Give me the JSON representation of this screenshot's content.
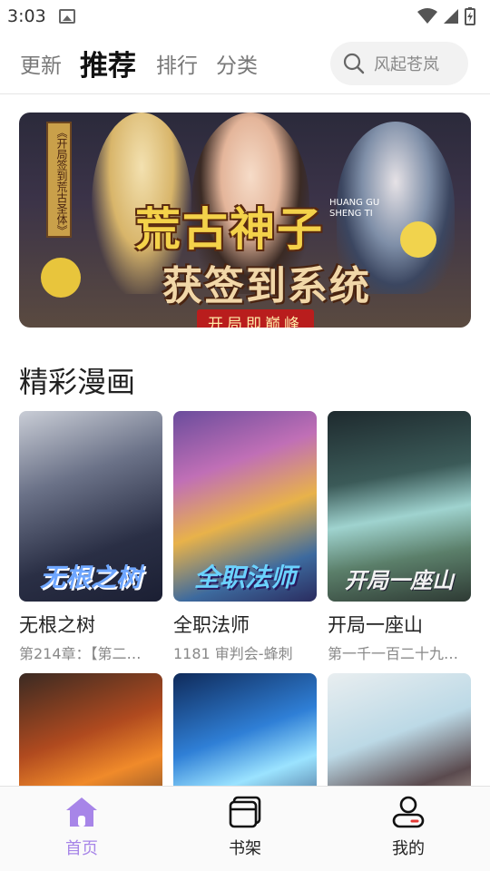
{
  "status": {
    "time": "3:03"
  },
  "tabs": [
    {
      "label": "更新"
    },
    {
      "label": "推荐"
    },
    {
      "label": "排行"
    },
    {
      "label": "分类"
    }
  ],
  "search": {
    "placeholder": "风起苍岚"
  },
  "banner": {
    "title_line1": "荒古神子",
    "title_line2": "获签到系统",
    "tag": "开局即巅峰",
    "vertical_text": "《开局签到荒古圣体》",
    "pinyin_1": "HUANG GU",
    "pinyin_2": "SHENG TI"
  },
  "section": {
    "title": "精彩漫画"
  },
  "comics": [
    {
      "title": "无根之树",
      "subtitle": "第214章：【第二…",
      "cover_text": "无根之树"
    },
    {
      "title": "全职法师",
      "subtitle": "1181 审判会-蜂刺",
      "cover_text": "全职法师"
    },
    {
      "title": "开局一座山",
      "subtitle": "第一千一百二十九…",
      "cover_text": "开局一座山"
    },
    {
      "title": "",
      "subtitle": "",
      "cover_text": ""
    },
    {
      "title": "",
      "subtitle": "",
      "cover_text": ""
    },
    {
      "title": "",
      "subtitle": "",
      "cover_text": ""
    }
  ],
  "nav": [
    {
      "label": "首页",
      "icon": "home-icon"
    },
    {
      "label": "书架",
      "icon": "bookshelf-icon"
    },
    {
      "label": "我的",
      "icon": "profile-icon"
    }
  ],
  "colors": {
    "accent": "#a785e8"
  }
}
